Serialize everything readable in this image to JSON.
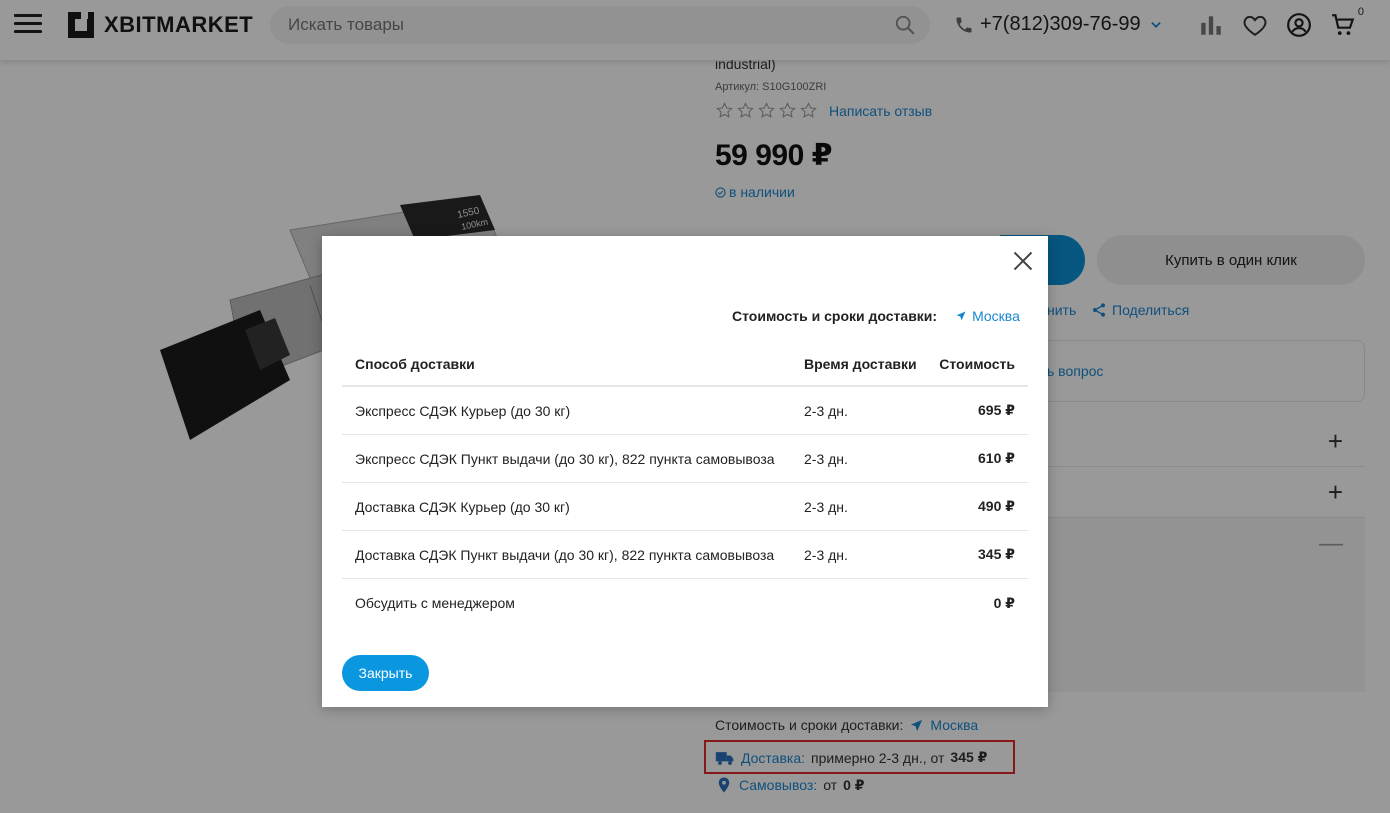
{
  "header": {
    "logo_text": "XBITMARKET",
    "search_placeholder": "Искать товары",
    "phone": "+7(812)309-76-99",
    "cart_count": "0"
  },
  "product": {
    "subtitle_fragment": "industrial)",
    "article": "Артикул: S10G100ZRI",
    "write_review": "Написать отзыв",
    "rating_stars": 0,
    "price": "59 990 ₽",
    "in_stock": "в наличии",
    "buy_one_click": "Купить в один клик",
    "compare_fragment": "нить",
    "share": "Поделиться",
    "ask_fragment": "ь вопрос",
    "image_label_1": "1550",
    "image_label_2": "100km"
  },
  "delivery_summary": {
    "title": "Стоимость и сроки доставки:",
    "city": "Москва",
    "delivery_link": "Доставка:",
    "delivery_text": "примерно 2-3 дн., от",
    "delivery_price": "345 ₽",
    "pickup_link": "Самовывоз:",
    "pickup_text": "от",
    "pickup_price": "0 ₽"
  },
  "modal": {
    "title": "Стоимость и сроки доставки:",
    "city": "Москва",
    "columns": [
      "Способ доставки",
      "Время доставки",
      "Стоимость"
    ],
    "rows": [
      {
        "method": "Экспресс СДЭК Курьер (до 30 кг)",
        "time": "2-3 дн.",
        "cost": "695 ₽"
      },
      {
        "method": "Экспресс СДЭК Пункт выдачи (до 30 кг), 822 пункта самовывоза",
        "time": "2-3 дн.",
        "cost": "610 ₽"
      },
      {
        "method": "Доставка СДЭК Курьер (до 30 кг)",
        "time": "2-3 дн.",
        "cost": "490 ₽"
      },
      {
        "method": "Доставка СДЭК Пункт выдачи (до 30 кг), 822 пункта самовывоза",
        "time": "2-3 дн.",
        "cost": "345 ₽"
      },
      {
        "method": "Обсудить с менеджером",
        "time": "",
        "cost": "0 ₽"
      }
    ],
    "close_button": "Закрыть"
  },
  "colors": {
    "accent": "#0b97e0",
    "link": "#1a86d0",
    "highlight_border": "#e02b2b"
  }
}
